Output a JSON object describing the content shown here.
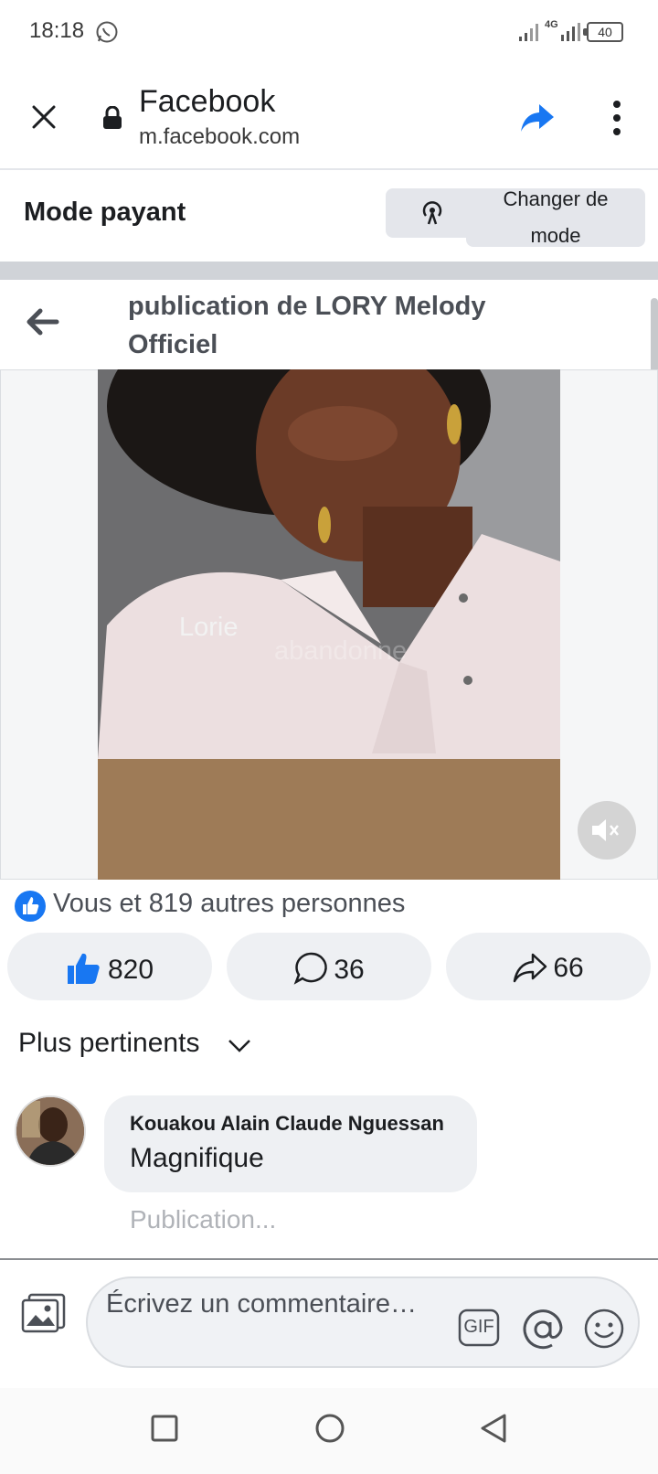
{
  "status_bar": {
    "time": "18:18",
    "network": "4G",
    "battery": "40",
    "icons": [
      "whatsapp-icon",
      "signal-icon",
      "battery-icon"
    ]
  },
  "browser": {
    "title": "Facebook",
    "url": "m.facebook.com",
    "accent_color": "#1877f2"
  },
  "mode_bar": {
    "label": "Mode payant",
    "change_label": "Changer de mode"
  },
  "post": {
    "title": "publication de LORY Melody Officiel",
    "video_overlay_text": "Lorie",
    "video_overlay_faded": "abandonne"
  },
  "reactions": {
    "summary": "Vous et 819 autres personnes",
    "likes": "820",
    "comments": "36",
    "shares": "66"
  },
  "comments_section": {
    "sort_label": "Plus pertinents",
    "items": [
      {
        "author": "Kouakou Alain Claude Nguessan",
        "text": "Magnifique",
        "pending": "Publication..."
      }
    ]
  },
  "composer": {
    "placeholder": "Écrivez un commentaire…",
    "gif_label": "GIF"
  }
}
